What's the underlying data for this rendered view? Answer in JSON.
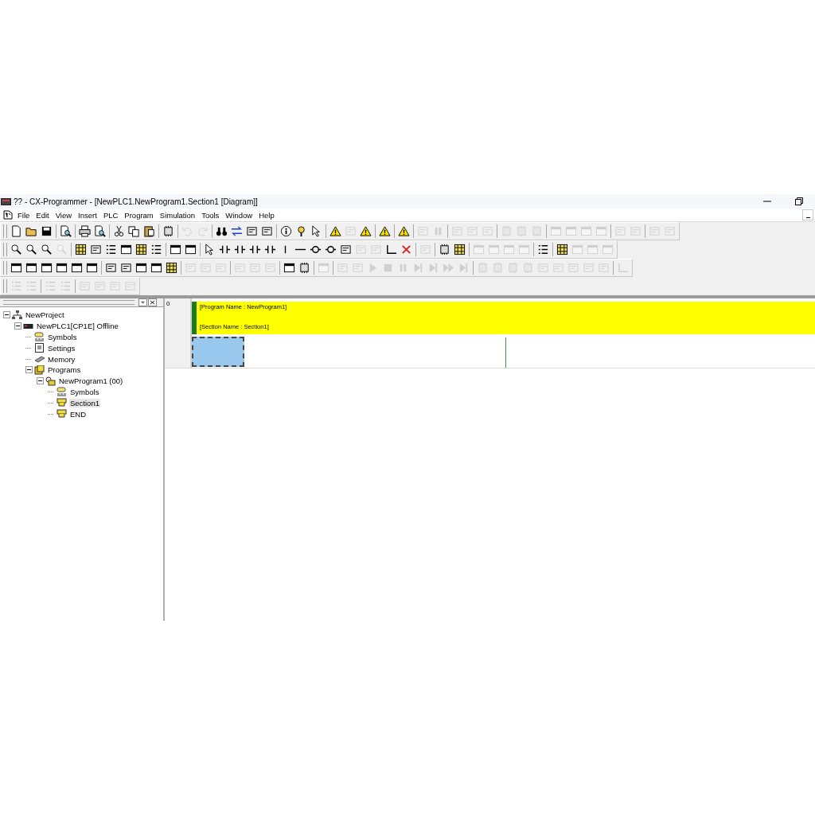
{
  "window": {
    "title": "?? - CX-Programmer - [NewPLC1.NewProgram1.Section1 [Diagram]]"
  },
  "menu": [
    "File",
    "Edit",
    "View",
    "Insert",
    "PLC",
    "Program",
    "Simulation",
    "Tools",
    "Window",
    "Help"
  ],
  "toolbars": [
    [
      [
        {
          "kind": "doc",
          "disabled": false
        },
        {
          "kind": "folder",
          "disabled": false
        },
        {
          "kind": "save",
          "disabled": false
        }
      ],
      [
        {
          "kind": "preview",
          "disabled": false
        }
      ],
      [
        {
          "kind": "print",
          "disabled": false
        },
        {
          "kind": "preview",
          "disabled": false
        }
      ],
      [
        {
          "kind": "cut",
          "disabled": false
        },
        {
          "kind": "copy",
          "disabled": false
        },
        {
          "kind": "paste",
          "disabled": false
        }
      ],
      [
        {
          "kind": "chip",
          "disabled": false
        }
      ],
      [
        {
          "kind": "undo",
          "disabled": true
        },
        {
          "kind": "redo",
          "disabled": true
        }
      ],
      [
        {
          "kind": "binoculars",
          "disabled": false
        },
        {
          "kind": "replace",
          "disabled": false
        },
        {
          "kind": "panel",
          "disabled": false
        },
        {
          "kind": "panel",
          "disabled": false
        }
      ],
      [
        {
          "kind": "info",
          "disabled": false
        },
        {
          "kind": "help",
          "disabled": false
        },
        {
          "kind": "cursor",
          "disabled": false
        }
      ],
      [
        {
          "kind": "warning",
          "disabled": false
        },
        {
          "kind": "panel",
          "disabled": true
        },
        {
          "kind": "warning",
          "disabled": false
        }
      ],
      [
        {
          "kind": "warning",
          "disabled": false
        }
      ],
      [
        {
          "kind": "warning",
          "disabled": false
        }
      ],
      [
        {
          "kind": "panel",
          "disabled": true
        },
        {
          "kind": "pause",
          "disabled": true
        }
      ],
      [
        {
          "kind": "panel",
          "disabled": true
        },
        {
          "kind": "panel",
          "disabled": true
        },
        {
          "kind": "panel",
          "disabled": true
        }
      ],
      [
        {
          "kind": "chip",
          "disabled": true
        },
        {
          "kind": "chip",
          "disabled": true
        },
        {
          "kind": "chip",
          "disabled": true
        }
      ],
      [
        {
          "kind": "window",
          "disabled": true
        },
        {
          "kind": "window",
          "disabled": true
        },
        {
          "kind": "window",
          "disabled": true
        },
        {
          "kind": "window",
          "disabled": true
        }
      ],
      [
        {
          "kind": "panel",
          "disabled": true
        },
        {
          "kind": "panel",
          "disabled": true
        }
      ],
      [
        {
          "kind": "panel",
          "disabled": true
        },
        {
          "kind": "panel",
          "disabled": true
        }
      ]
    ],
    [
      [
        {
          "kind": "zoom",
          "disabled": false
        },
        {
          "kind": "zoom",
          "disabled": false
        },
        {
          "kind": "zoom",
          "disabled": false
        },
        {
          "kind": "zoom",
          "disabled": true
        }
      ],
      [
        {
          "kind": "grid",
          "disabled": false
        },
        {
          "kind": "panel",
          "disabled": false
        },
        {
          "kind": "list",
          "disabled": false
        },
        {
          "kind": "window",
          "disabled": false
        },
        {
          "kind": "grid",
          "disabled": false
        },
        {
          "kind": "list",
          "disabled": false
        }
      ],
      [
        {
          "kind": "window",
          "disabled": false
        },
        {
          "kind": "window",
          "disabled": false
        }
      ],
      [
        {
          "kind": "cursor",
          "disabled": false
        },
        {
          "kind": "contact",
          "disabled": false
        },
        {
          "kind": "contact",
          "disabled": false
        },
        {
          "kind": "contact",
          "disabled": false
        },
        {
          "kind": "contact",
          "disabled": false
        },
        {
          "kind": "vline",
          "disabled": false
        },
        {
          "kind": "line",
          "disabled": false
        },
        {
          "kind": "coil",
          "disabled": false
        },
        {
          "kind": "coil",
          "disabled": false
        },
        {
          "kind": "panel",
          "disabled": false
        },
        {
          "kind": "panel",
          "disabled": true
        },
        {
          "kind": "panel",
          "disabled": true
        },
        {
          "kind": "corner",
          "disabled": false
        },
        {
          "kind": "cross",
          "disabled": false
        }
      ],
      [
        {
          "kind": "panel",
          "disabled": true
        }
      ],
      [
        {
          "kind": "chip",
          "disabled": false
        },
        {
          "kind": "grid",
          "disabled": false
        }
      ],
      [
        {
          "kind": "window",
          "disabled": true
        },
        {
          "kind": "window",
          "disabled": true
        },
        {
          "kind": "window",
          "disabled": true
        },
        {
          "kind": "window",
          "disabled": true
        }
      ],
      [
        {
          "kind": "list",
          "disabled": false
        }
      ],
      [
        {
          "kind": "grid",
          "disabled": false
        },
        {
          "kind": "window",
          "disabled": true
        },
        {
          "kind": "window",
          "disabled": true
        },
        {
          "kind": "window",
          "disabled": true
        }
      ]
    ],
    [
      [
        {
          "kind": "window",
          "disabled": false
        },
        {
          "kind": "window",
          "disabled": false
        },
        {
          "kind": "window",
          "disabled": false
        },
        {
          "kind": "window",
          "disabled": false
        },
        {
          "kind": "window",
          "disabled": false
        },
        {
          "kind": "window",
          "disabled": false
        }
      ],
      [
        {
          "kind": "panel",
          "disabled": false
        },
        {
          "kind": "panel",
          "disabled": false
        },
        {
          "kind": "window",
          "disabled": false
        },
        {
          "kind": "window",
          "disabled": false
        },
        {
          "kind": "grid",
          "disabled": false
        }
      ],
      [
        {
          "kind": "panel",
          "disabled": true
        },
        {
          "kind": "panel",
          "disabled": true
        },
        {
          "kind": "panel",
          "disabled": true
        }
      ],
      [
        {
          "kind": "panel",
          "disabled": true
        },
        {
          "kind": "panel",
          "disabled": true
        },
        {
          "kind": "panel",
          "disabled": true
        }
      ],
      [
        {
          "kind": "window",
          "disabled": false
        },
        {
          "kind": "chip",
          "disabled": false
        }
      ],
      [
        {
          "kind": "window",
          "disabled": true
        }
      ],
      [
        {
          "kind": "panel",
          "disabled": true
        },
        {
          "kind": "panel",
          "disabled": true
        },
        {
          "kind": "play",
          "disabled": true
        },
        {
          "kind": "stop",
          "disabled": true
        },
        {
          "kind": "pause",
          "disabled": true
        },
        {
          "kind": "step",
          "disabled": true
        },
        {
          "kind": "step",
          "disabled": true
        },
        {
          "kind": "fast",
          "disabled": true
        },
        {
          "kind": "step",
          "disabled": true
        }
      ],
      [
        {
          "kind": "chip",
          "disabled": true
        },
        {
          "kind": "chip",
          "disabled": true
        },
        {
          "kind": "chip",
          "disabled": true
        },
        {
          "kind": "chip",
          "disabled": true
        },
        {
          "kind": "panel",
          "disabled": true
        },
        {
          "kind": "panel",
          "disabled": true
        },
        {
          "kind": "panel",
          "disabled": true
        },
        {
          "kind": "panel",
          "disabled": true
        },
        {
          "kind": "panel",
          "disabled": true
        }
      ],
      [
        {
          "kind": "corner",
          "disabled": true
        }
      ]
    ],
    [
      [
        {
          "kind": "list",
          "disabled": true
        },
        {
          "kind": "list",
          "disabled": true
        }
      ],
      [
        {
          "kind": "list",
          "disabled": true
        },
        {
          "kind": "list",
          "disabled": true
        }
      ],
      [
        {
          "kind": "panel",
          "disabled": true
        },
        {
          "kind": "panel",
          "disabled": true
        },
        {
          "kind": "panel",
          "disabled": true
        },
        {
          "kind": "panel",
          "disabled": true
        }
      ]
    ]
  ],
  "tree": [
    {
      "label": "NewProject",
      "kind": "project",
      "selected": false,
      "expanded": true,
      "children": [
        {
          "label": "NewPLC1[CP1E] Offline",
          "kind": "plc",
          "selected": false,
          "expanded": true,
          "children": [
            {
              "label": "Symbols",
              "kind": "symbols",
              "selected": false
            },
            {
              "label": "Settings",
              "kind": "settings",
              "selected": false
            },
            {
              "label": "Memory",
              "kind": "memory",
              "selected": false
            },
            {
              "label": "Programs",
              "kind": "programs",
              "selected": false,
              "expanded": true,
              "children": [
                {
                  "label": "NewProgram1 (00)",
                  "kind": "program",
                  "selected": false,
                  "expanded": true,
                  "children": [
                    {
                      "label": "Symbols",
                      "kind": "symbols",
                      "selected": false
                    },
                    {
                      "label": "Section1",
                      "kind": "section",
                      "selected": true
                    },
                    {
                      "label": "END",
                      "kind": "section",
                      "selected": false
                    }
                  ]
                }
              ]
            }
          ]
        }
      ]
    }
  ],
  "diagram": {
    "rung_number": "0",
    "program_comment": "[Program Name : NewProgram1]",
    "section_comment": "[Section Name : Section1]"
  }
}
